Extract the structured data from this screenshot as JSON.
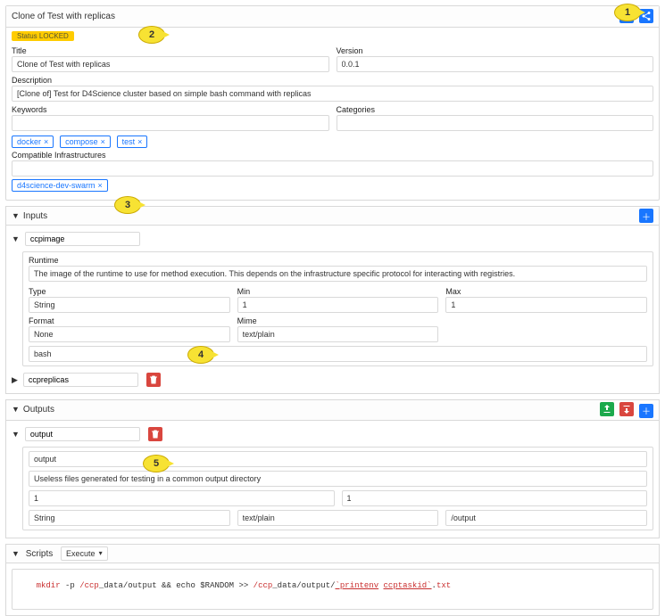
{
  "page_title": "Clone of Test with replicas",
  "status_badge": "Status LOCKED",
  "general": {
    "title_label": "Title",
    "title_value": "Clone of Test with replicas",
    "version_label": "Version",
    "version_value": "0.0.1",
    "description_label": "Description",
    "description_value": "[Clone of] Test for D4Science cluster based on simple bash command with replicas",
    "keywords_label": "Keywords",
    "categories_label": "Categories",
    "keyword_tags": [
      "docker",
      "compose",
      "test"
    ],
    "compat_label": "Compatible Infrastructures",
    "compat_tags": [
      "d4science-dev-swarm"
    ]
  },
  "inputs": {
    "section_label": "Inputs",
    "items": [
      {
        "name": "ccpimage",
        "expanded": true,
        "runtime_label": "Runtime",
        "runtime_desc": "The image of the runtime to use for method execution. This depends on the infrastructure specific protocol for interacting with registries.",
        "type_label": "Type",
        "type_value": "String",
        "min_label": "Min",
        "min_value": "1",
        "max_label": "Max",
        "max_value": "1",
        "format_label": "Format",
        "format_value": "None",
        "mime_label": "Mime",
        "mime_value": "text/plain",
        "default_value": "bash"
      },
      {
        "name": "ccpreplicas",
        "expanded": false
      }
    ]
  },
  "outputs": {
    "section_label": "Outputs",
    "items": [
      {
        "name": "output",
        "expanded": true,
        "title_value": "output",
        "desc_value": "Useless files generated for testing in a common output directory",
        "min_value": "1",
        "max_value": "1",
        "type_value": "String",
        "mime_value": "text/plain",
        "path_value": "/output"
      }
    ]
  },
  "scripts": {
    "section_label": "Scripts",
    "mode_label": "Execute",
    "code": "mkdir -p /ccp_data/output && echo $RANDOM >> /ccp_data/output/ printenv ccptaskid/.txt"
  },
  "annotations": {
    "a1": "1",
    "a2": "2",
    "a3": "3",
    "a4": "4",
    "a5": "5"
  }
}
